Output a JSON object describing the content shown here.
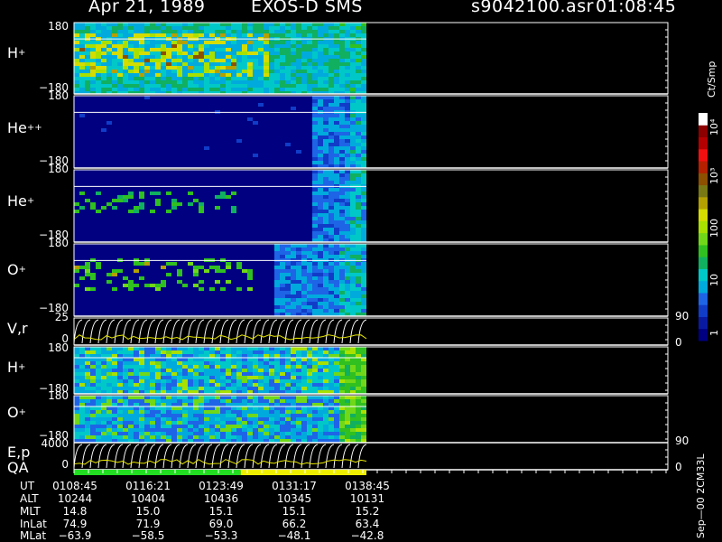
{
  "header": {
    "date": "Apr 21, 1989",
    "instrument": "EXOS-D SMS",
    "file": "s9042100.asr",
    "time": "01:08:45"
  },
  "chart_data": {
    "type": "heatmap",
    "panels": [
      {
        "label": "H",
        "charge": "+",
        "ytop": "180",
        "ybottom": "−180",
        "kind": "spectrogram",
        "profile": "h1"
      },
      {
        "label": "He",
        "charge": "++",
        "ytop": "180",
        "ybottom": "−180",
        "kind": "spectrogram",
        "profile": "he2"
      },
      {
        "label": "He",
        "charge": "+",
        "ytop": "180",
        "ybottom": "−180",
        "kind": "spectrogram",
        "profile": "he1"
      },
      {
        "label": "O",
        "charge": "+",
        "ytop": "180",
        "ybottom": "−180",
        "kind": "spectrogram",
        "profile": "o1"
      },
      {
        "label": "V,r",
        "charge": "",
        "ytop": "25",
        "ybottom": "0",
        "right_top": "90",
        "right_bottom": "0",
        "kind": "line"
      },
      {
        "label": "H",
        "charge": "+",
        "ytop": "180",
        "ybottom": "−180",
        "kind": "spectrogram",
        "profile": "h2"
      },
      {
        "label": "O",
        "charge": "+",
        "ytop": "180",
        "ybottom": "−180",
        "kind": "spectrogram",
        "profile": "o2"
      },
      {
        "label": "E,p",
        "charge": "",
        "ytop": "4000",
        "ybottom": "0",
        "right_top": "90",
        "right_bottom": "0",
        "kind": "line"
      }
    ],
    "qa_label": "QA",
    "qa_segments": [
      {
        "color": "#22dd22",
        "fraction": 0.57
      },
      {
        "color": "#eeee00",
        "fraction": 0.43
      }
    ],
    "colorbar": {
      "unit": "Ct/Smp",
      "ticks": [
        "1",
        "10",
        "100",
        "10³",
        "10⁴"
      ],
      "colors": [
        "#000080",
        "#0a1aa0",
        "#103cc8",
        "#1e64e6",
        "#00aadc",
        "#00c8c8",
        "#10b060",
        "#30c020",
        "#70d818",
        "#a8e000",
        "#d4dc00",
        "#b4a000",
        "#787814",
        "#8c5000",
        "#b42000",
        "#f01010",
        "#b40000",
        "#8c0000",
        "#ffffff"
      ]
    },
    "footer": {
      "rows": [
        {
          "label": "UT",
          "values": [
            "0108:45",
            "0116:21",
            "0123:49",
            "0131:17",
            "0138:45"
          ]
        },
        {
          "label": "ALT",
          "values": [
            "10244",
            "10404",
            "10436",
            "10345",
            "10131"
          ]
        },
        {
          "label": "MLT",
          "values": [
            "14.8",
            "15.0",
            "15.1",
            "15.1",
            "15.2"
          ]
        },
        {
          "label": "InLat",
          "values": [
            "74.9",
            "71.9",
            "69.0",
            "66.2",
            "63.4"
          ]
        },
        {
          "label": "MLat",
          "values": [
            "−63.9",
            "−58.5",
            "−53.3",
            "−48.1",
            "−42.8"
          ]
        }
      ]
    },
    "side_note": "Sep—00  2CM33L"
  }
}
